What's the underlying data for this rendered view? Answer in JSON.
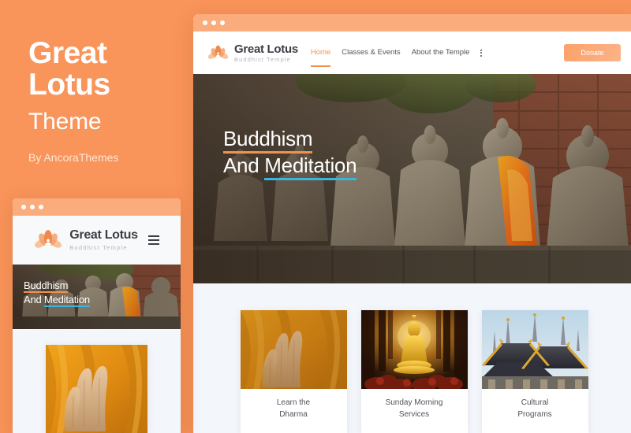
{
  "promo": {
    "title_line1": "Great",
    "title_line2": "Lotus",
    "subtitle": "Theme",
    "byline": "By AncoraThemes",
    "background_color": "#f9945a",
    "text_color": "#ffffff"
  },
  "site": {
    "brand": {
      "name": "Great Lotus",
      "tagline": "Buddhist Temple",
      "logo_icon": "lotus-icon"
    },
    "nav": [
      {
        "label": "Home",
        "active": true
      },
      {
        "label": "Classes & Events",
        "active": false
      },
      {
        "label": "About the Temple",
        "active": false
      }
    ],
    "nav_more_icon": "more-vertical-icon",
    "donate_button": {
      "label": "Donate",
      "color": "#fba26b"
    },
    "hero": {
      "line1": "Buddhism",
      "line2_prefix": "And ",
      "line2_highlight": "Meditation",
      "underline_color_1": "#f2924f",
      "underline_color_2": "#3bb5de"
    },
    "cards": [
      {
        "title_line1": "Learn the",
        "title_line2": "Dharma",
        "icon": "lotus-icon",
        "image": "monks-praying-hands"
      },
      {
        "title_line1": "Sunday Morning",
        "title_line2": "Services",
        "icon": "lotus-icon",
        "image": "golden-buddha-statue"
      },
      {
        "title_line1": "Cultural",
        "title_line2": "Programs",
        "icon": "lotus-icon",
        "image": "thai-temple-roof"
      }
    ],
    "section_background": "#f3f6fb"
  },
  "mobile_preview": {
    "brand": {
      "name": "Great Lotus",
      "tagline": "Buddhist Temple",
      "logo_icon": "lotus-icon"
    },
    "menu_icon": "hamburger-menu-icon",
    "hero": {
      "line1": "Buddhism",
      "line2_prefix": "And ",
      "line2_highlight": "Meditation"
    },
    "card": {
      "image": "monks-praying-hands"
    }
  },
  "window_chrome": {
    "dots": [
      "dot-1",
      "dot-2",
      "dot-3"
    ],
    "bar_color": "#fbac7c"
  }
}
